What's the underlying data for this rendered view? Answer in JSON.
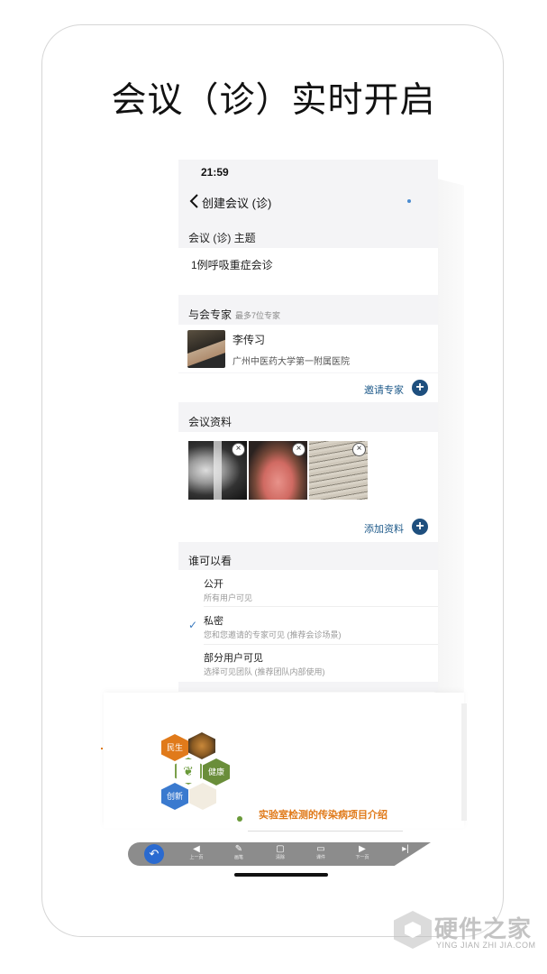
{
  "headline": "会议（诊）实时开启",
  "phone": {
    "status_time": "21:59",
    "nav_title": "创建会议 (诊)",
    "topic_section": {
      "label": "会议 (诊) 主题",
      "value": "1例呼吸重症会诊"
    },
    "experts_section": {
      "label": "与会专家",
      "sub": "最多7位专家",
      "expert": {
        "name": "李传习",
        "hospital": "广州中医药大学第一附属医院"
      },
      "invite_label": "邀请专家"
    },
    "materials_section": {
      "label": "会议资料",
      "thumbnails": [
        {
          "name": "chest-xray"
        },
        {
          "name": "tongue-photo"
        },
        {
          "name": "document-photo"
        }
      ],
      "add_label": "添加资料"
    },
    "visibility_section": {
      "label": "谁可以看",
      "options": [
        {
          "title": "公开",
          "desc": "所有用户可见",
          "selected": false
        },
        {
          "title": "私密",
          "desc": "您和您邀请的专家可见 (推荐会诊场景)",
          "selected": true
        },
        {
          "title": "部分用户可见",
          "desc": "选择可见团队 (推荐团队内部使用)",
          "selected": false
        }
      ]
    }
  },
  "slide": {
    "hex_labels": [
      "民生",
      "健康",
      "创新"
    ],
    "title": "实验室检测的传染病项目介绍"
  },
  "toolbar": {
    "items": [
      {
        "icon": "arrow-left-icon",
        "label": "上一页"
      },
      {
        "icon": "pen-icon",
        "label": "画笔"
      },
      {
        "icon": "trash-icon",
        "label": "清除"
      },
      {
        "icon": "folder-icon",
        "label": "课件"
      },
      {
        "icon": "arrow-right-icon",
        "label": "下一页"
      }
    ]
  },
  "watermark": {
    "text": "硬件之家",
    "sub": "YING JIAN ZHI JIA.COM"
  },
  "colors": {
    "accent": "#1e4f7e",
    "orange": "#e07a1a",
    "check": "#3a7abf"
  }
}
